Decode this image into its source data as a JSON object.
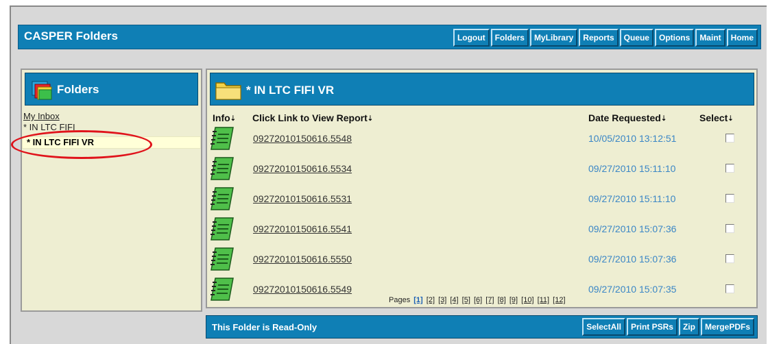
{
  "header": {
    "title": "CASPER Folders",
    "nav": [
      "Logout",
      "Folders",
      "MyLibrary",
      "Reports",
      "Queue",
      "Options",
      "Maint",
      "Home"
    ]
  },
  "sidebar": {
    "title": "Folders",
    "items": [
      "My Inbox",
      "* IN LTC FIFI",
      "* IN LTC FIFI VR"
    ]
  },
  "main": {
    "folder_title": "* IN LTC FIFI VR",
    "columns": {
      "info": "Info",
      "report": "Click Link to View Report",
      "date": "Date Requested",
      "select": "Select"
    },
    "rows": [
      {
        "report": "09272010150616.5548",
        "date": "10/05/2010 13:12:51"
      },
      {
        "report": "09272010150616.5534",
        "date": "09/27/2010 15:11:10"
      },
      {
        "report": "09272010150616.5531",
        "date": "09/27/2010 15:11:10"
      },
      {
        "report": "09272010150616.5541",
        "date": "09/27/2010 15:07:36"
      },
      {
        "report": "09272010150616.5550",
        "date": "09/27/2010 15:07:36"
      },
      {
        "report": "09272010150616.5549",
        "date": "09/27/2010 15:07:35"
      }
    ],
    "pages_label": "Pages",
    "pages": [
      "[1]",
      "[2]",
      "[3]",
      "[4]",
      "[5]",
      "[6]",
      "[7]",
      "[8]",
      "[9]",
      "[10]",
      "[11]",
      "[12]"
    ],
    "current_page": "[1]"
  },
  "footer": {
    "status": "This Folder is Read-Only",
    "buttons": [
      "SelectAll",
      "Print PSRs",
      "Zip",
      "MergePDFs"
    ]
  },
  "colors": {
    "bar_blue": "#0f7fb5",
    "panel_bg": "#eeeed2",
    "selected_bg": "#ffffd8",
    "date_blue": "#3a86c6",
    "annotation_red": "#e0131b"
  }
}
